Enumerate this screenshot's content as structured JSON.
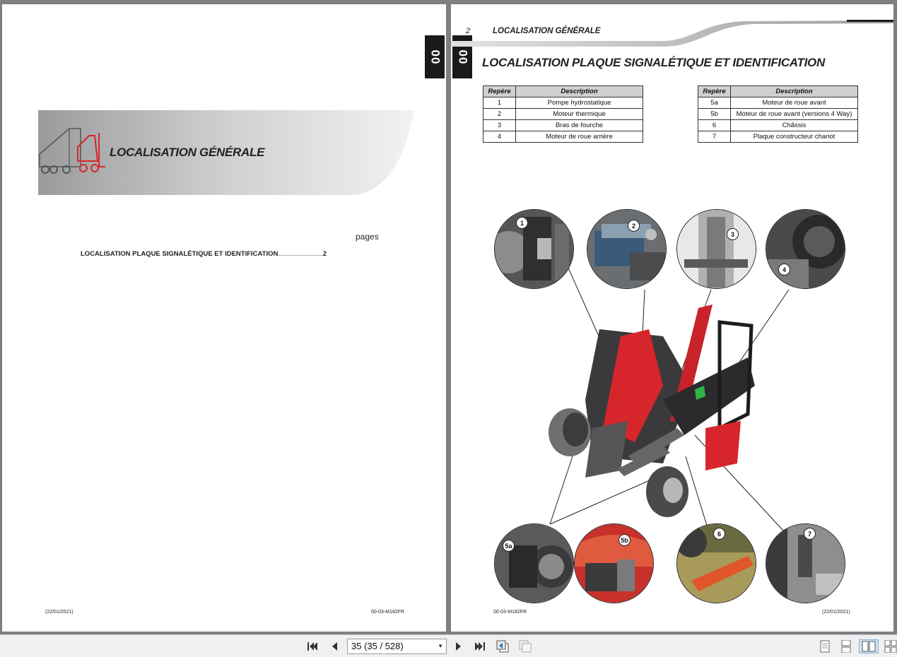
{
  "left_page": {
    "tab_label": "00",
    "banner_title": "LOCALISATION GÉNÉRALE",
    "toc_header": "pages",
    "toc_entries": [
      {
        "label": "LOCALISATION PLAQUE SIGNALÉTIQUE ET IDENTIFICATION",
        "dots": "........................",
        "page": "2"
      }
    ],
    "footer_date": "(22/01/2021)",
    "footer_ref": "00-03-M182FR"
  },
  "right_page": {
    "tab_label": "00",
    "header_page_number": "2",
    "header_title": "LOCALISATION GÉNÉRALE",
    "title": "LOCALISATION PLAQUE SIGNALÉTIQUE ET IDENTIFICATION",
    "table_headers": {
      "ref": "Repère",
      "desc": "Description"
    },
    "table_a": [
      {
        "ref": "1",
        "desc": "Pompe hydrostatique"
      },
      {
        "ref": "2",
        "desc": "Moteur thermique"
      },
      {
        "ref": "3",
        "desc": "Bras de fourche"
      },
      {
        "ref": "4",
        "desc": "Moteur de roue arrière"
      }
    ],
    "table_b": [
      {
        "ref": "5a",
        "desc": "Moteur de roue avant"
      },
      {
        "ref": "5b",
        "desc": "Moteur de roue avant (versions 4 Way)"
      },
      {
        "ref": "6",
        "desc": "Châssis"
      },
      {
        "ref": "7",
        "desc": "Plaque constructeur chariot"
      }
    ],
    "callouts": [
      "1",
      "2",
      "3",
      "4",
      "5a",
      "5b",
      "6",
      "7"
    ],
    "footer_ref": "00-03-M182FR",
    "footer_date": "(22/01/2021)"
  },
  "toolbar": {
    "page_indicator": "35 (35 / 528)",
    "icons": [
      "first-page-icon",
      "previous-page-icon",
      "next-page-icon",
      "last-page-icon",
      "back-view-icon",
      "forward-view-icon",
      "single-page-icon",
      "continuous-icon",
      "two-page-icon",
      "two-page-continuous-icon"
    ]
  },
  "colors": {
    "accent_red": "#d7262b",
    "tab_dark": "#1a1a1a",
    "viewer_bg": "#7d7f82"
  }
}
